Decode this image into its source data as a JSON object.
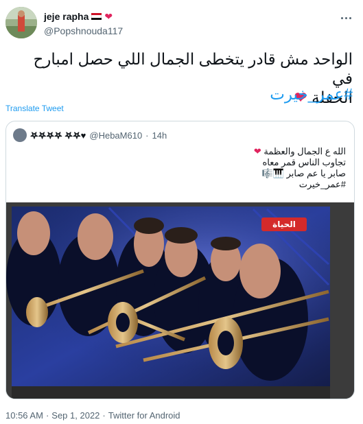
{
  "author": {
    "name": "jeje rapha",
    "handle": "@Popshnouda117",
    "emoji": "❤"
  },
  "tweet": {
    "text_line1": "الواحد مش قادر يتخطى الجمال اللي حصل امبارح في",
    "text_line2": "الحفلة",
    "heart": "❤",
    "hashtag": "#عمر_خيرت",
    "translate_label": "Translate Tweet"
  },
  "quoted": {
    "name": "𖤐𖤐𖤐𖤐 𖤐𖤐♥",
    "handle": "@HebaM610",
    "separator": "·",
    "time": "14h",
    "line1_text": "الله ع  الجمال والعظمة",
    "line1_heart": "❤",
    "line2": "تجاوب الناس قمر معاه",
    "line3": "صابر يا عم صابر 🎹🎼",
    "line4": "#عمر_خيرت",
    "channel_logo": "الحياة"
  },
  "meta": {
    "time": "10:56 AM",
    "dot1": "·",
    "date": "Sep 1, 2022",
    "dot2": "·",
    "app": "Twitter for Android"
  },
  "colors": {
    "link": "#1d9bf0",
    "heart": "#e0245e",
    "muted": "#536471",
    "border": "#cfd9de"
  },
  "icons": {
    "more": "more-icon",
    "flag": "egypt-flag-icon"
  }
}
